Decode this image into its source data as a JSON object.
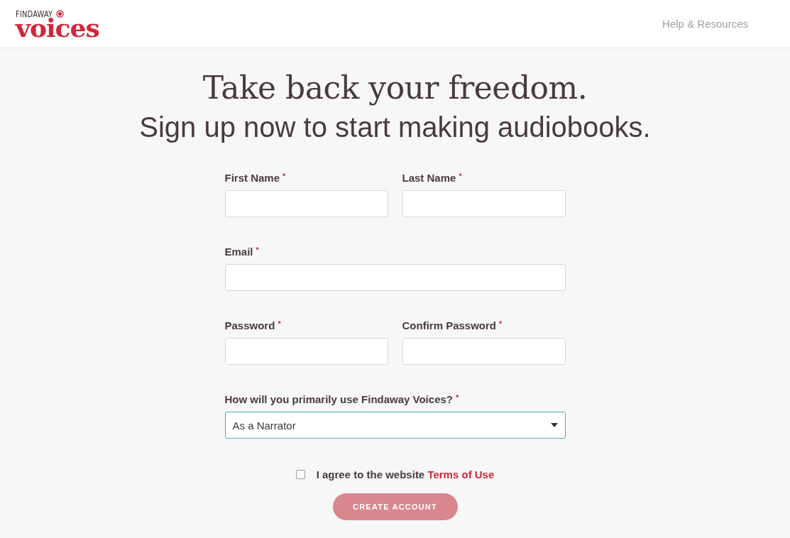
{
  "header": {
    "logo": {
      "top": "FINDAWAY",
      "main": "voices"
    },
    "links": [
      "Help & Resources"
    ]
  },
  "hero": {
    "title": "Take back your freedom.",
    "subtitle": "Sign up now to start making audiobooks."
  },
  "form": {
    "rows": [
      {
        "fields": [
          {
            "kind": "text",
            "label": "First Name",
            "required_mark": "*"
          },
          {
            "kind": "text",
            "label": "Last Name",
            "required_mark": "*"
          }
        ]
      },
      {
        "fields": [
          {
            "kind": "text",
            "label": "Email",
            "required_mark": "*"
          }
        ]
      },
      {
        "fields": [
          {
            "kind": "text",
            "label": "Password",
            "required_mark": "*"
          },
          {
            "kind": "text",
            "label": "Confirm Password",
            "required_mark": "*"
          }
        ]
      },
      {
        "fields": [
          {
            "kind": "select",
            "label": "How will you primarily use Findaway Voices?",
            "required_mark": "*",
            "value": "As a Narrator",
            "focused": true
          }
        ]
      }
    ],
    "agree": {
      "checked": false,
      "text": "I agree to the website",
      "link": "Terms of Use"
    },
    "submit": {
      "label": "CREATE ACCOUNT",
      "disabled": true
    }
  }
}
